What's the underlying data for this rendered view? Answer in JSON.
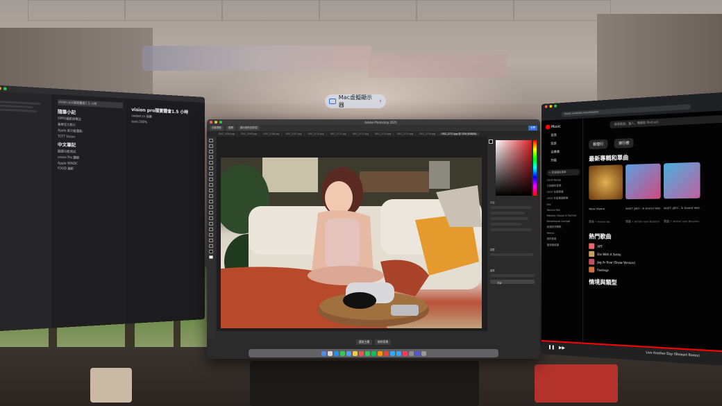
{
  "virtual_display_pill": {
    "label": "Mac虛擬顯示器",
    "chevron": "›"
  },
  "notes": {
    "doc_title": "vision pro隨實體會1.5 小時",
    "list_item_1": "vision pro隨實體會1.5 小時",
    "doc_lines": [
      "seebot.cn 接續",
      "tools 500%"
    ],
    "sections": [
      "隨筆小記",
      "中文筆記"
    ],
    "list_rows": [
      "OPPO攝影師專訪",
      "蘋果官方影片",
      "Apple 新功能重點",
      "TCFT Vision",
      "翻譯功能測試",
      "vision Pro 體驗",
      "Apple WWDC",
      "FOOD 攝影"
    ]
  },
  "photoshop": {
    "title": "Adobe Photoshop 2025",
    "share_label": "分享",
    "tabs": [
      "DSC_2394.jpg",
      "DSC_2395.jpg",
      "DSC_2706.jpg",
      "DSC_2707.jpg",
      "DSC_2710.jpg",
      "DSC_2711.jpg",
      "DSC_2713.jpg",
      "DSC_2714.jpg",
      "DSC_2715.jpg",
      "DSC_2716.jpg",
      "DSC_2717.jpg @ 33% (RGB/8)"
    ],
    "options": [
      "自動選取",
      "圖層",
      "顯示變形控制項"
    ],
    "bottom_buttons": [
      "選取主體",
      "移除背景"
    ],
    "panel_labels": [
      "內容",
      "調整",
      "圖層",
      "背景"
    ]
  },
  "youtube_music": {
    "address": "music.youtube.com/explore",
    "logo": "Music",
    "search_placeholder": "搜尋歌曲、藝人、專輯和 Podcast",
    "nav": [
      "首頁",
      "探索",
      "音樂庫",
      "升級"
    ],
    "new_playlist": "+ 新增播放清單",
    "sidebar_lists": [
      "2024 Recap",
      "已按讚的音樂",
      "2024 年度精選",
      "2024 年度專屬歌單",
      "Mix",
      "Techno Mix",
      "Melodic House & Techno",
      "Deephouse Lounge",
      "浪漫的抒情歌",
      "Remix",
      "我的音樂",
      "搖滾樂精選"
    ],
    "pills": [
      "新發行",
      "排行榜"
    ],
    "section_new": "最新專輯和單曲",
    "albums": [
      {
        "title": "Wow Hipera",
        "sub": "單曲 • Fernando"
      },
      {
        "title": "AGET (JEO - A Grand Voice of Transit Episode",
        "sub": "單曲 • Armin van Buuren"
      },
      {
        "title": "AGET (JEO - A Grand Voice of Transit Episode",
        "sub": "單曲 • Armin van Buuren"
      }
    ],
    "section_hot": "熱門歌曲",
    "songs": [
      "APT.",
      "Die With A Smile",
      "Jag Ar Kvar (Snow Version)",
      "Feelings"
    ],
    "section_mood": "情境與類型",
    "now_playing": "Live Another Day (Stewart Remix)"
  },
  "colors": {
    "accent_blue": "#2f6fe0",
    "ytm_red": "#ff0000"
  }
}
